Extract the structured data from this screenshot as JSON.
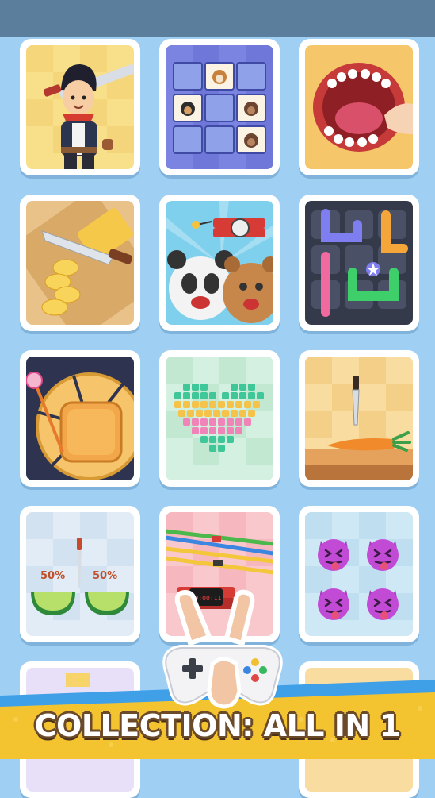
{
  "banner": {
    "title": "COLLECTION: ALL IN 1"
  },
  "games": [
    {
      "id": "sword-hero",
      "icon": "hero-with-sword"
    },
    {
      "id": "memory-match",
      "icon": "dog-tiles"
    },
    {
      "id": "dentist",
      "icon": "open-mouth-teeth"
    },
    {
      "id": "cut-butter",
      "icon": "knife-slicing"
    },
    {
      "id": "bomb-friends",
      "icon": "panda-bear-dynamite"
    },
    {
      "id": "pipe-connect",
      "icon": "color-pipes"
    },
    {
      "id": "cake-cut",
      "icon": "round-cake-knife"
    },
    {
      "id": "heart-arrows",
      "icon": "arrow-heart-puzzle"
    },
    {
      "id": "carrot-slice",
      "icon": "carrot-knife"
    },
    {
      "id": "watermelon-split",
      "icon": "watermelon-halves",
      "left_percent": "50%",
      "right_percent": "50%"
    },
    {
      "id": "wire-bomb",
      "icon": "wires-bomb-timer",
      "timer": "00:00:11"
    },
    {
      "id": "emoji-match",
      "icon": "devil-emojis"
    }
  ],
  "colors": {
    "background": "#9fd0f4",
    "status_bar": "#5b7e9c",
    "banner_yellow": "#f4c430",
    "banner_outline": "#6b4a2a"
  }
}
